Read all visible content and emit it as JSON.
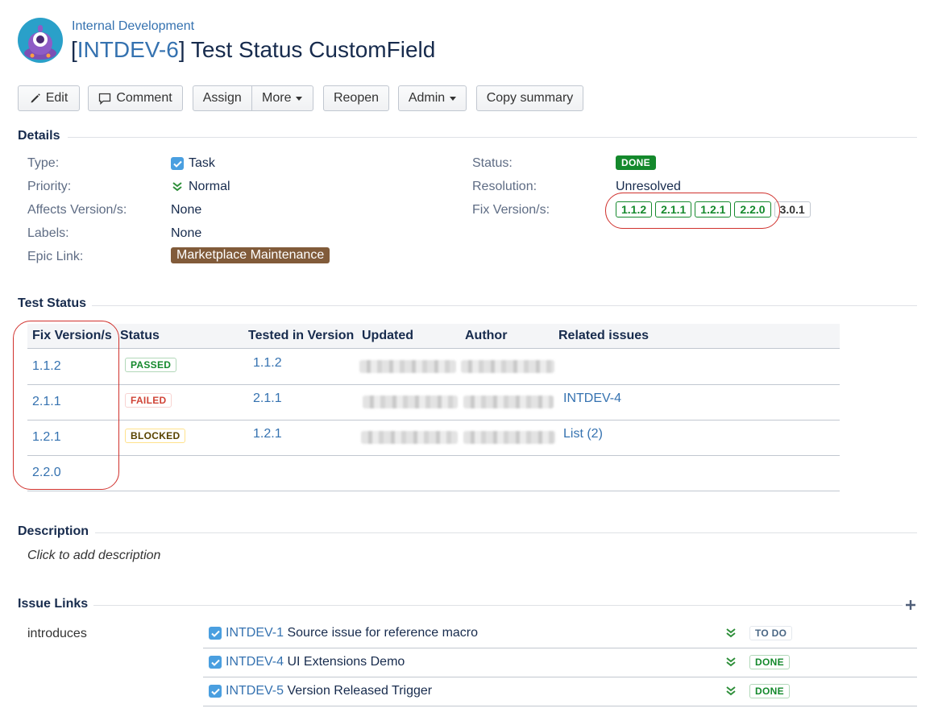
{
  "header": {
    "project": "Internal Development",
    "issue_key": "INTDEV-6",
    "summary": "Test Status CustomField"
  },
  "toolbar": {
    "edit": "Edit",
    "comment": "Comment",
    "assign": "Assign",
    "more": "More",
    "reopen": "Reopen",
    "admin": "Admin",
    "copy_summary": "Copy summary"
  },
  "details": {
    "heading": "Details",
    "type_label": "Type:",
    "type_value": "Task",
    "priority_label": "Priority:",
    "priority_value": "Normal",
    "affects_label": "Affects Version/s:",
    "affects_value": "None",
    "labels_label": "Labels:",
    "labels_value": "None",
    "epic_label": "Epic Link:",
    "epic_value": "Marketplace Maintenance",
    "status_label": "Status:",
    "status_value": "DONE",
    "resolution_label": "Resolution:",
    "resolution_value": "Unresolved",
    "fix_label": "Fix Version/s:",
    "fix_versions": [
      "1.1.2",
      "2.1.1",
      "1.2.1",
      "2.2.0",
      "3.0.1"
    ]
  },
  "test_status": {
    "heading": "Test Status",
    "columns": [
      "Fix Version/s",
      "Status",
      "Tested in Version",
      "Updated",
      "Author",
      "Related issues"
    ],
    "rows": [
      {
        "fix": "1.1.2",
        "status": "PASSED",
        "tested": "1.1.2",
        "related": ""
      },
      {
        "fix": "2.1.1",
        "status": "FAILED",
        "tested": "2.1.1",
        "related": "INTDEV-4"
      },
      {
        "fix": "1.2.1",
        "status": "BLOCKED",
        "tested": "1.2.1",
        "related": "List (2)"
      },
      {
        "fix": "2.2.0",
        "status": "",
        "tested": "",
        "related": ""
      }
    ]
  },
  "description": {
    "heading": "Description",
    "placeholder": "Click to add description"
  },
  "issue_links": {
    "heading": "Issue Links",
    "relation": "introduces",
    "links": [
      {
        "key": "INTDEV-1",
        "summary": "Source issue for reference macro",
        "status": "TO DO"
      },
      {
        "key": "INTDEV-4",
        "summary": "UI Extensions Demo",
        "status": "DONE"
      },
      {
        "key": "INTDEV-5",
        "summary": "Version Released Trigger",
        "status": "DONE"
      }
    ]
  },
  "colors": {
    "link": "#3572b0",
    "done_green": "#14892c",
    "failed_red": "#d04437",
    "epic_brown": "#815b3a",
    "annotation_red": "#d0312d"
  }
}
